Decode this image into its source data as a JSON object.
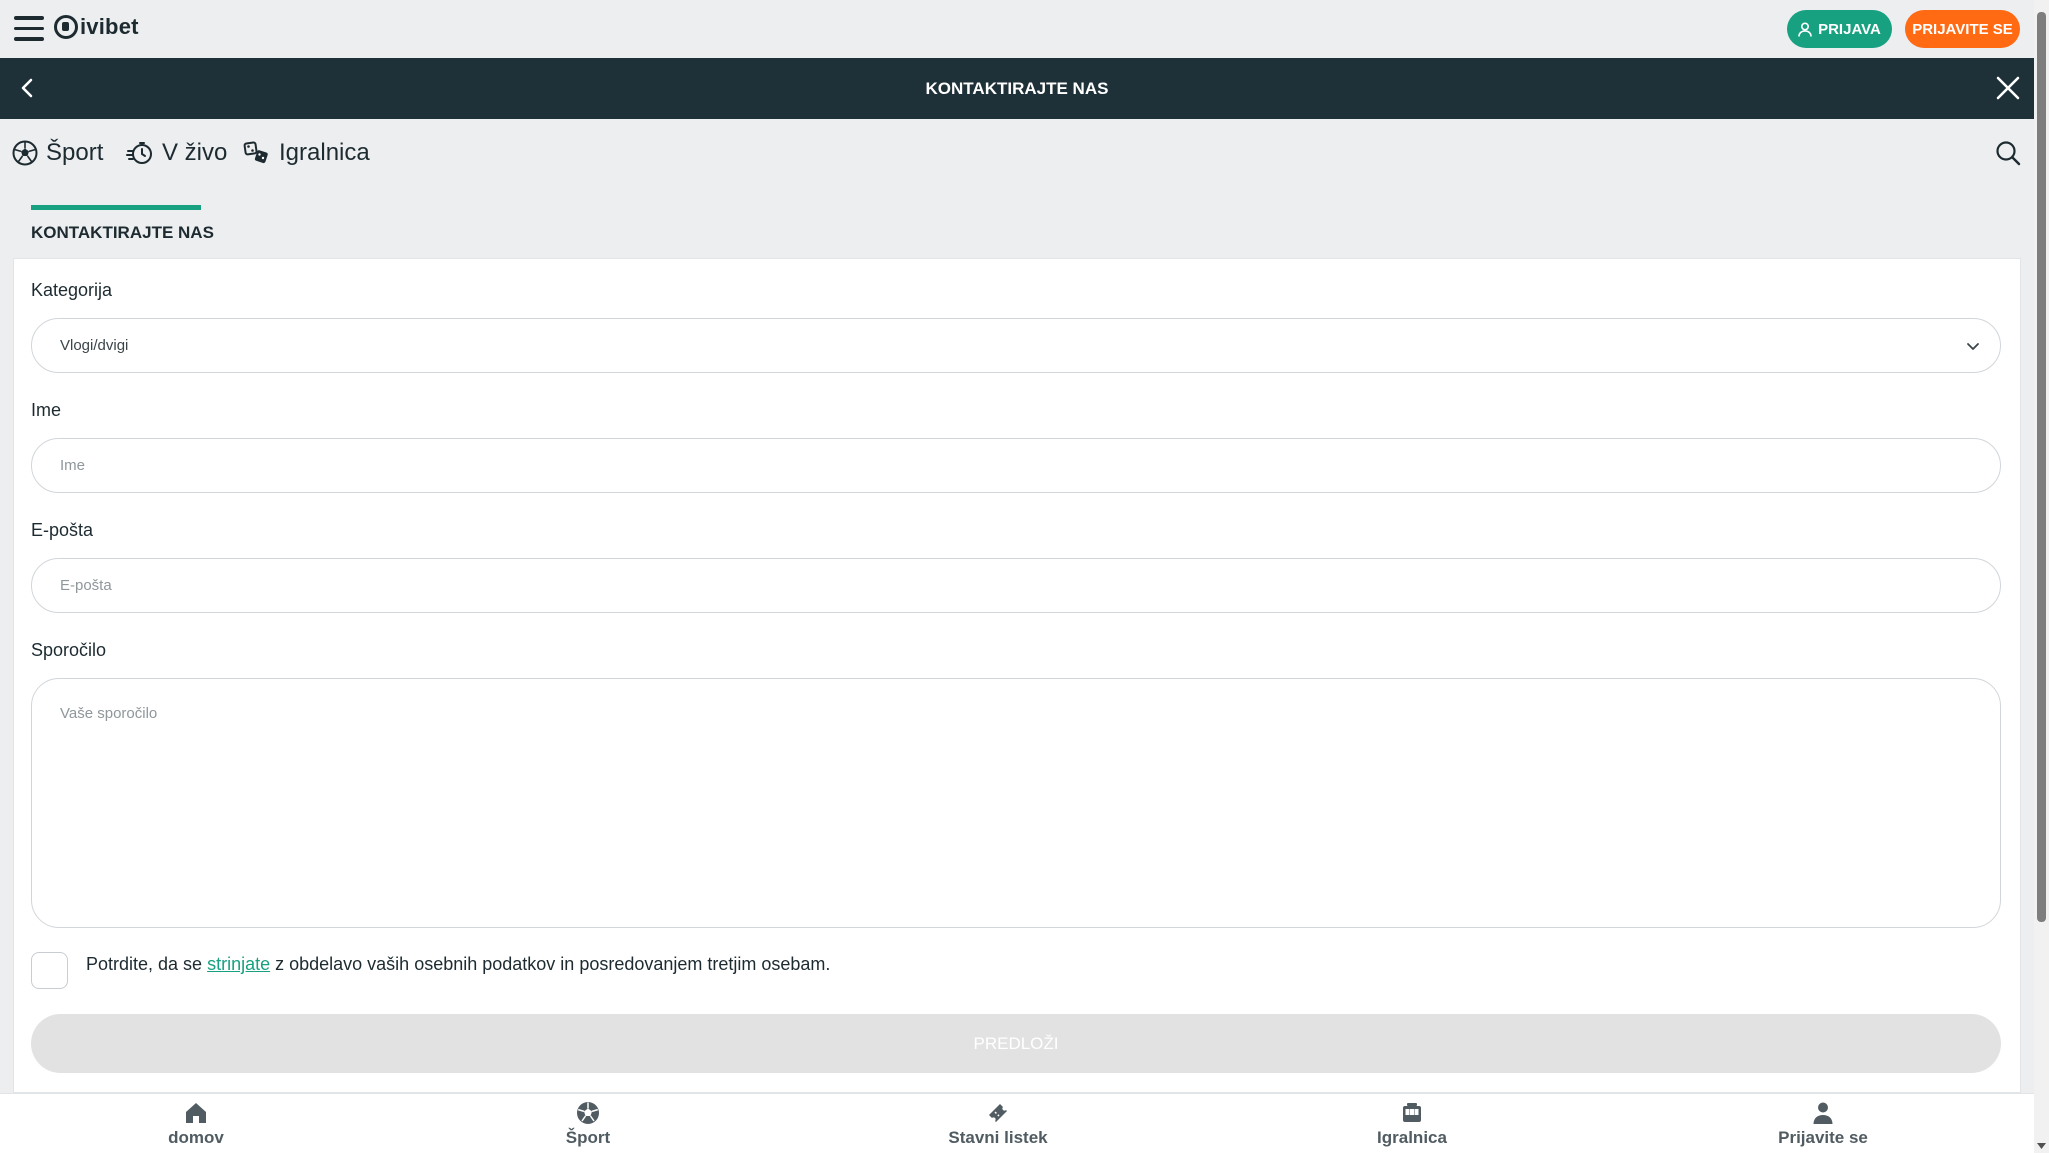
{
  "header": {
    "logo_text": "ivibet",
    "login_label": "PRIJAVA",
    "register_label": "PRIJAVITE SE",
    "colors": {
      "login": "#18a180",
      "register": "#ff6a13",
      "titlebar": "#1e3038"
    }
  },
  "titlebar": {
    "title": "KONTAKTIRAJTE NAS"
  },
  "nav": {
    "items": [
      {
        "label": "Šport",
        "icon": "soccer-ball-icon"
      },
      {
        "label": "V živo",
        "icon": "live-stopwatch-icon"
      },
      {
        "label": "Igralnica",
        "icon": "dice-icon"
      }
    ]
  },
  "section": {
    "tab_label": "KONTAKTIRAJTE NAS"
  },
  "form": {
    "category_label": "Kategorija",
    "category_value": "Vlogi/dvigi",
    "name_label": "Ime",
    "name_placeholder": "Ime",
    "email_label": "E-pošta",
    "email_placeholder": "E-pošta",
    "message_label": "Sporočilo",
    "message_placeholder": "Vaše sporočilo",
    "consent_before": "Potrdite, da se ",
    "consent_link": "strinjate",
    "consent_after": " z obdelavo vaših osebnih podatkov in posredovanjem tretjim osebam.",
    "submit_label": "PREDLOŽI"
  },
  "bottom_nav": {
    "items": [
      {
        "label": "domov",
        "icon": "home-icon"
      },
      {
        "label": "Šport",
        "icon": "soccer-ball-icon"
      },
      {
        "label": "Stavni listek",
        "icon": "ticket-icon"
      },
      {
        "label": "Igralnica",
        "icon": "slot-machine-icon"
      },
      {
        "label": "Prijavite se",
        "icon": "user-icon"
      }
    ]
  }
}
